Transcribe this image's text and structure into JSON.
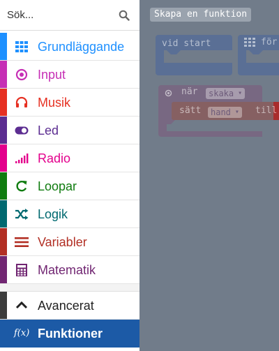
{
  "search": {
    "placeholder": "Sök..."
  },
  "toolbox": {
    "categories": [
      {
        "label": "Grundläggande",
        "color": "#1e90ff",
        "icon": "grid-icon"
      },
      {
        "label": "Input",
        "color": "#c62fb5",
        "icon": "circle-dot-icon"
      },
      {
        "label": "Musik",
        "color": "#e63022",
        "icon": "headphones-icon"
      },
      {
        "label": "Led",
        "color": "#5c2d91",
        "icon": "toggle-icon"
      },
      {
        "label": "Radio",
        "color": "#e3008c",
        "icon": "signal-bars-icon"
      },
      {
        "label": "Loopar",
        "color": "#107c10",
        "icon": "refresh-icon"
      },
      {
        "label": "Logik",
        "color": "#006970",
        "icon": "shuffle-icon"
      },
      {
        "label": "Variabler",
        "color": "#b22f24",
        "icon": "list-lines-icon"
      },
      {
        "label": "Matematik",
        "color": "#712672",
        "icon": "calculator-icon"
      }
    ],
    "advanced": {
      "label": "Avancerat",
      "color": "#3c3c3c",
      "icon": "chevron-up-icon"
    },
    "functions": {
      "label": "Funktioner",
      "color": "#1c5aa6",
      "icon": "function-icon",
      "icon_text": "f(x)"
    }
  },
  "workspace": {
    "create_function_label": "Skapa en funktion",
    "blocks": {
      "on_start": "vid start",
      "forever": "för",
      "on_gesture": "när",
      "gesture_value": "skaka",
      "set": "sätt",
      "variable": "hand",
      "to": "till"
    }
  }
}
